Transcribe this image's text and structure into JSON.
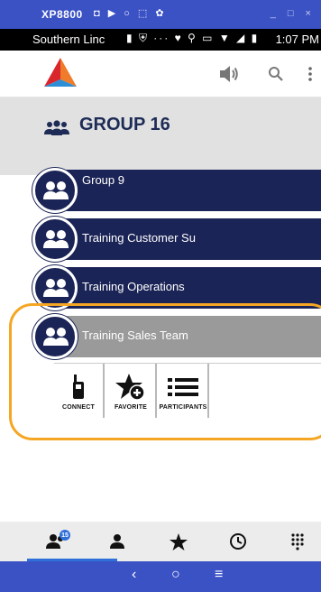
{
  "emulator": {
    "title": "XP8800",
    "glyphs": "◘ ▶ ○ ⬚ ✿",
    "window_controls": "_ □ ×"
  },
  "status_bar": {
    "carrier": "Southern Linc",
    "icons": "▮ ⛨ ··· ♥ ⚲ ▭ ▼ ◢ ▮",
    "time": "1:07 PM"
  },
  "header": {
    "logo": "tri-color-logo",
    "icons": [
      "speaker-icon",
      "search-icon",
      "more-vert-icon"
    ]
  },
  "group": {
    "title": "GROUP 16",
    "icon": "group-icon"
  },
  "groups": [
    {
      "label": "Group 9"
    },
    {
      "label": "Training Customer Su"
    },
    {
      "label": "Training Operations"
    },
    {
      "label": "Training Sales Team",
      "selected": true
    }
  ],
  "actions": [
    {
      "label": "CONNECT",
      "icon": "radio-icon"
    },
    {
      "label": "FAVORITE",
      "icon": "star-add-icon"
    },
    {
      "label": "PARTICIPANTS",
      "icon": "list-icon"
    }
  ],
  "bottom_nav": [
    {
      "name": "groups",
      "icon": "groups-icon",
      "badge": "15",
      "active": true
    },
    {
      "name": "contacts",
      "icon": "person-icon"
    },
    {
      "name": "favorites",
      "icon": "star-icon"
    },
    {
      "name": "history",
      "icon": "clock-icon"
    },
    {
      "name": "dialpad",
      "icon": "dialpad-icon"
    }
  ],
  "system_nav": {
    "back": "‹",
    "home": "○",
    "recents": "≡"
  },
  "colors": {
    "navy": "#1b2456",
    "selected_gray": "#9a9a9a",
    "highlight": "#f5a623",
    "system_blue": "#3b52c5",
    "accent": "#2e6fd8"
  }
}
